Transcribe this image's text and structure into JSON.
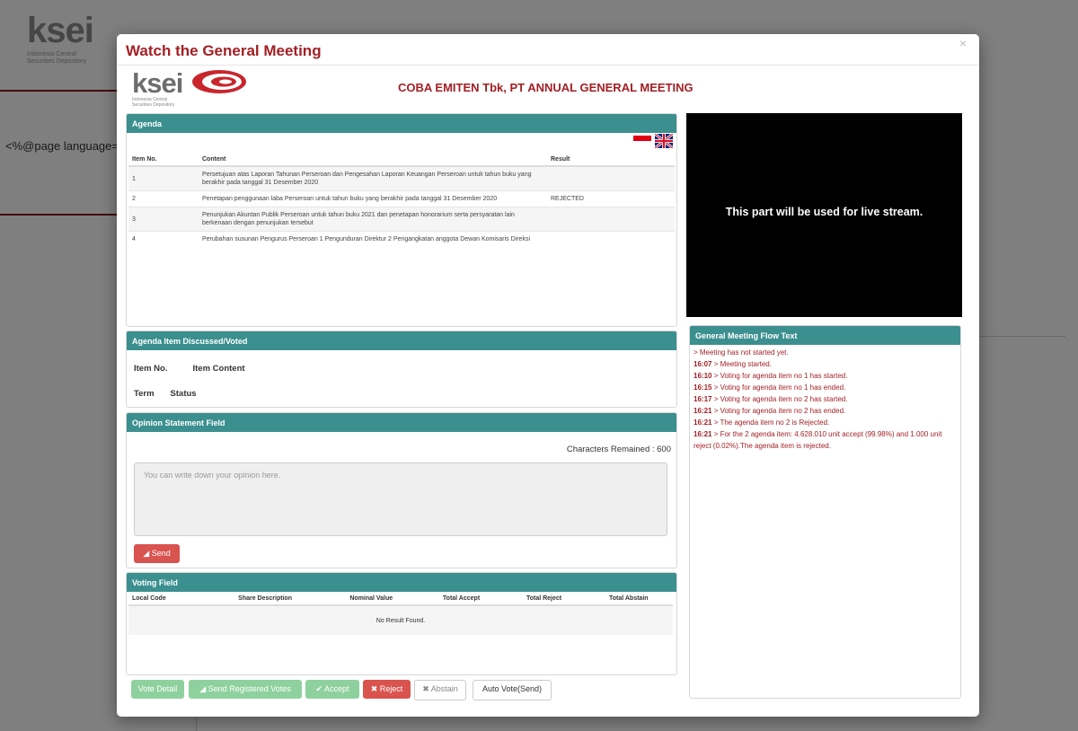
{
  "background": {
    "logo_text": "ksei",
    "logo_sub": "Indonesia Central Securities Depository",
    "code_text": "<%@page language=\"j"
  },
  "modal": {
    "title": "Watch the General Meeting",
    "close_glyph": "×",
    "logo_text": "ksei",
    "logo_sub": "Indonesia Central Securities Depository",
    "meeting_title": "COBA EMITEN Tbk, PT ANNUAL GENERAL MEETING"
  },
  "agenda": {
    "heading": "Agenda",
    "columns": {
      "item_no": "Item No.",
      "content": "Content",
      "result": "Result"
    },
    "rows": [
      {
        "no": "1",
        "content": "Persetujuan atas Laporan Tahunan Perseroan dan Pengesahan Laporan Keuangan Perseroan untuk tahun buku yang berakhir pada tanggal 31 Desember 2020",
        "result": ""
      },
      {
        "no": "2",
        "content": "Penetapan penggunaan laba Perseroan untuk tahun buku yang berakhir pada tanggal 31 Desember 2020",
        "result": "REJECTED"
      },
      {
        "no": "3",
        "content": "Penunjukan Akuntan Publik Perseroan untuk tahun buku 2021 dan penetapan honorarium serta persyaratan lain berkenaan dengan penunjukan tersebut",
        "result": ""
      },
      {
        "no": "4",
        "content": "Perubahan susunan Pengurus Perseroan 1 Pengunduran Direktur 2 Pengangkatan anggota Dewan Komisaris Direksi",
        "result": ""
      }
    ]
  },
  "discussed": {
    "heading": "Agenda Item Discussed/Voted",
    "item_no_label": "Item No.",
    "item_content_label": "Item Content",
    "term_label": "Term",
    "status_label": "Status"
  },
  "opinion": {
    "heading": "Opinion Statement Field",
    "chars_remaining": "Characters Remained : 600",
    "placeholder": "You can write down your opinion here.",
    "send_label": "Send"
  },
  "voting": {
    "heading": "Voting Field",
    "columns": [
      "Local Code",
      "Share Description",
      "Nominal Value",
      "Total Accept",
      "Total Reject",
      "Total Abstain"
    ],
    "empty_message": "No Result Found."
  },
  "buttons": {
    "vote_detail": "Vote Detail",
    "send_registered": "Send Registered Votes",
    "accept": "Accept",
    "reject": "Reject",
    "abstain": "Abstain",
    "auto_vote": "Auto Vote(Send)"
  },
  "stream": {
    "text": "This part will be used for live stream."
  },
  "flow": {
    "heading": "General Meeting Flow Text",
    "lines": [
      {
        "time": "",
        "text": "> Meeting has not started yet."
      },
      {
        "time": "16:07",
        "text": " > Meeting started."
      },
      {
        "time": "16:10",
        "text": " > Voting for agenda item no 1 has started."
      },
      {
        "time": "16:15",
        "text": " > Voting for agenda item no 1 has ended."
      },
      {
        "time": "16:17",
        "text": " > Voting for agenda item no 2 has started."
      },
      {
        "time": "16:21",
        "text": " > Voting for agenda item no 2 has ended."
      },
      {
        "time": "16:21",
        "text": " > The agenda item no 2 is Rejected."
      },
      {
        "time": "16:21",
        "text": " > For the 2 agenda item: 4.628.010 unit accept (99.98%) and 1.000 unit reject (0.02%).The agenda item is rejected."
      }
    ]
  },
  "colors": {
    "brand_red": "#a31f24",
    "panel_header": "#3c8f8f",
    "success_light": "#8fd19e",
    "danger": "#d9534f"
  }
}
